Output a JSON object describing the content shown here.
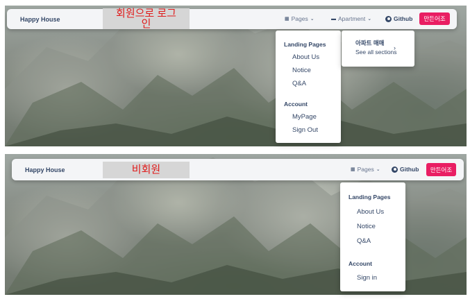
{
  "top": {
    "brand": "Happy House",
    "annotation_line1": "회원으로 로그",
    "annotation_line2": "인",
    "nav": {
      "pages_label": "Pages",
      "apartment_label": "Apartment",
      "github_label": "Github",
      "cta_label": "만든어조"
    },
    "dropdown": {
      "landing_heading": "Landing Pages",
      "landing_items": [
        "About Us",
        "Notice",
        "Q&A"
      ],
      "account_heading": "Account",
      "account_items": [
        "MyPage",
        "Sign Out"
      ]
    },
    "submenu": {
      "title": "아파트 매매",
      "description": "See all sections",
      "arrow": "›"
    }
  },
  "bottom": {
    "brand": "Happy House",
    "annotation": "비회원",
    "nav": {
      "pages_label": "Pages",
      "github_label": "Github",
      "cta_label": "만든어조"
    },
    "dropdown": {
      "landing_heading": "Landing Pages",
      "landing_items": [
        "About Us",
        "Notice",
        "Q&A"
      ],
      "account_heading": "Account",
      "account_items": [
        "Sign in"
      ]
    }
  },
  "icons": {
    "pages": "grid-icon",
    "apartment": "building-icon",
    "chevron": "chevron-down-icon",
    "github": "github-icon",
    "submenu_arrow": "chevron-right-icon"
  },
  "colors": {
    "cta": "#e91e63",
    "annotation_text": "#e01b1b",
    "annotation_bg": "#d6d6d6",
    "text_dark": "#344767"
  }
}
